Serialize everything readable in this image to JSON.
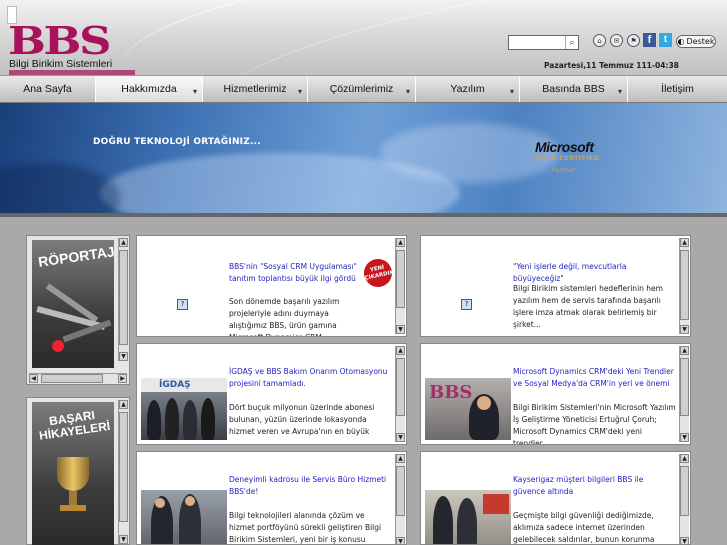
{
  "brand": {
    "logo_letters": "BBS",
    "tagline": "Bilgi Birikim Sistemleri"
  },
  "header": {
    "search_placeholder": "",
    "date_text": "Pazartesi,11 Temmuz 111-04:38",
    "destek_label": "Destek",
    "icons": [
      "home-icon",
      "mail-icon",
      "flag-icon",
      "facebook-icon",
      "twitter-icon"
    ]
  },
  "nav": {
    "items": [
      {
        "label": "Ana Sayfa",
        "dropdown": false
      },
      {
        "label": "Hakkımızda",
        "dropdown": true
      },
      {
        "label": "Hizmetlerimiz",
        "dropdown": true
      },
      {
        "label": "Çözümlerimiz",
        "dropdown": true
      },
      {
        "label": "Yazılım",
        "dropdown": true
      },
      {
        "label": "Basında BBS",
        "dropdown": true
      },
      {
        "label": "İletişim",
        "dropdown": false
      }
    ]
  },
  "banner": {
    "slogan": "DOĞRU TEKNOLOJİ ORTAĞINIZ...",
    "ms_logo": "Microsoft",
    "ms_partner": "GOLD CERTIFIED",
    "ms_sub": "Partner"
  },
  "sidebar": {
    "box1_title": "RÖPORTAJLAR",
    "box2_title": "BAŞARI HİKAYELERİ"
  },
  "news_left": [
    {
      "title": "BBS'nin \"Sosyal CRM Uygulaması\" tanıtım toplantısı büyük ilgi gördü",
      "body": "Son dönemde başarılı yazılım projeleriyle adını duymaya alıştığımız BBS, ürün gamına Microsoft Dynamics CRM...",
      "badge": "YENİ ÇIKARDIK"
    },
    {
      "title": "İGDAŞ ve BBS Bakım Onarım Otomasyonu projesini tamamladı.",
      "body": "Dört buçuk milyonun üzerinde abonesi bulunan, yüzün üzerinde lokasyonda hizmet veren ve Avrupa'nın en büyük",
      "logo": "İGDAŞ"
    },
    {
      "title": "Deneyimli kadrosu ile Servis Büro Hizmeti BBS'de!",
      "body": "Bilgi teknolojileri alanında çözüm ve hizmet portföyünü sürekli geliştiren Bilgi Birikim Sistemleri, yeni bir iş konusu olarak Servis"
    }
  ],
  "news_right": [
    {
      "title": "\"Yeni işlerle değil, mevcutlarla büyüyeceğiz\"",
      "body": "Bilgi Birikim sistemleri hedeflerinin hem yazılım hem de servis tarafında başarılı işlere imza atmak olarak belirlemiş bir şirket..."
    },
    {
      "title": "Microsoft Dynamics CRM'deki Yeni Trendler ve Sosyal Medya'da CRM'in yeri ve önemi",
      "body": "Bilgi Birikim Sistemleri'nin Microsoft Yazılım İş Geliştirme Yöneticisi Ertuğrul Çoruh; Microsoft Dynamics CRM'deki yeni trendler..."
    },
    {
      "title": "Kayserigaz müşteri bilgileri BBS ile güvence altında",
      "body": "Geçmişte bilgi güvenliği dediğimizde, aklımıza sadece internet üzerinden gelebilecek saldırılar, bunun korunma"
    }
  ],
  "colors": {
    "brand": "#a8125c",
    "link": "#1f1fc2",
    "nav_bg": "#d0d0d0"
  }
}
